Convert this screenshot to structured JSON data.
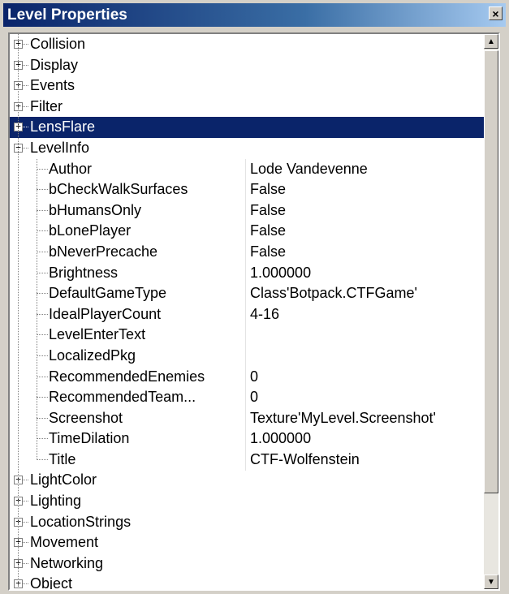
{
  "window": {
    "title": "Level Properties",
    "close_glyph": "×"
  },
  "tree": {
    "categories_top": [
      {
        "label": "Collision",
        "expander": "+"
      },
      {
        "label": "Display",
        "expander": "+"
      },
      {
        "label": "Events",
        "expander": "+"
      },
      {
        "label": "Filter",
        "expander": "+"
      },
      {
        "label": "LensFlare",
        "expander": "+",
        "selected": true
      },
      {
        "label": "LevelInfo",
        "expander": "−"
      }
    ],
    "level_info_properties": [
      {
        "name": "Author",
        "value": "Lode Vandevenne"
      },
      {
        "name": "bCheckWalkSurfaces",
        "value": "False"
      },
      {
        "name": "bHumansOnly",
        "value": "False"
      },
      {
        "name": "bLonePlayer",
        "value": "False"
      },
      {
        "name": "bNeverPrecache",
        "value": "False"
      },
      {
        "name": "Brightness",
        "value": "1.000000"
      },
      {
        "name": "DefaultGameType",
        "value": "Class'Botpack.CTFGame'"
      },
      {
        "name": "IdealPlayerCount",
        "value": "4-16"
      },
      {
        "name": "LevelEnterText",
        "value": ""
      },
      {
        "name": "LocalizedPkg",
        "value": ""
      },
      {
        "name": "RecommendedEnemies",
        "value": "0"
      },
      {
        "name": "RecommendedTeam...",
        "value": "0"
      },
      {
        "name": "Screenshot",
        "value": "Texture'MyLevel.Screenshot'"
      },
      {
        "name": "TimeDilation",
        "value": "1.000000"
      },
      {
        "name": "Title",
        "value": "CTF-Wolfenstein"
      }
    ],
    "categories_bottom": [
      {
        "label": "LightColor",
        "expander": "+"
      },
      {
        "label": "Lighting",
        "expander": "+"
      },
      {
        "label": "LocationStrings",
        "expander": "+"
      },
      {
        "label": "Movement",
        "expander": "+"
      },
      {
        "label": "Networking",
        "expander": "+"
      },
      {
        "label": "Object",
        "expander": "+"
      }
    ]
  },
  "scrollbar": {
    "up_glyph": "▲",
    "down_glyph": "▼"
  },
  "colors": {
    "title_gradient_start": "#0a246a",
    "title_gradient_end": "#a6caf0",
    "selection": "#0a246a",
    "chrome": "#d4d0c8"
  }
}
